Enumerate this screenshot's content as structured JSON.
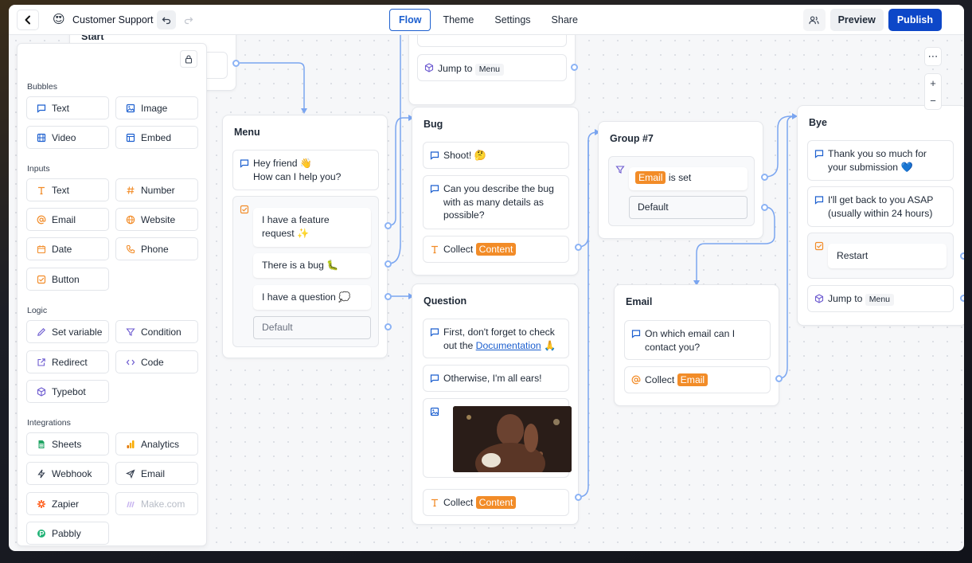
{
  "header": {
    "bot_name": "Customer Support",
    "bot_emoji": "😍",
    "tabs": [
      "Flow",
      "Theme",
      "Settings",
      "Share"
    ],
    "active_tab": "Flow",
    "preview_label": "Preview",
    "publish_label": "Publish"
  },
  "sidebar": {
    "sections": {
      "bubbles": "Bubbles",
      "inputs": "Inputs",
      "logic": "Logic",
      "integrations": "Integrations"
    },
    "bubbles": [
      "Text",
      "Image",
      "Video",
      "Embed"
    ],
    "inputs": [
      "Text",
      "Number",
      "Email",
      "Website",
      "Date",
      "Phone",
      "Button"
    ],
    "logic": [
      "Set variable",
      "Condition",
      "Redirect",
      "Code",
      "Typebot"
    ],
    "integrations": [
      "Sheets",
      "Analytics",
      "Webhook",
      "Email",
      "Zapier",
      "Make.com",
      "Pabbly"
    ]
  },
  "flow": {
    "start": {
      "title": "Start"
    },
    "top": {
      "jump_label": "Jump to",
      "jump_target": "Menu"
    },
    "menu": {
      "title": "Menu",
      "bubble_line1": "Hey friend 👋",
      "bubble_line2": "How can I help you?",
      "options": [
        "I have a feature request ✨",
        "There is a bug 🐛",
        "I have a question 💭"
      ],
      "default": "Default"
    },
    "bug": {
      "title": "Bug",
      "msg1": "Shoot! 🤔",
      "msg2": "Can you describe the bug with as many details as possible?",
      "collect_label": "Collect",
      "collect_var": "Content"
    },
    "question": {
      "title": "Question",
      "msg1_before": "First, don't forget to check out the ",
      "msg1_link": "Documentation",
      "msg1_after": " 🙏",
      "msg2": "Otherwise, I'm all ears!",
      "collect_label": "Collect",
      "collect_var": "Content"
    },
    "group7": {
      "title": "Group #7",
      "cond_var": "Email",
      "cond_text": "is set",
      "default": "Default"
    },
    "email": {
      "title": "Email",
      "msg": "On which email can I contact you?",
      "collect_label": "Collect",
      "collect_var": "Email"
    },
    "bye": {
      "title": "Bye",
      "msg1": "Thank you so much for your submission 💙",
      "msg2": "I'll get back to you ASAP (usually within 24 hours)",
      "restart": "Restart",
      "jump_label": "Jump to",
      "jump_target": "Menu"
    }
  },
  "zoom": {
    "in": "+",
    "out": "−",
    "more": "⋯"
  },
  "colors": {
    "accent": "#0d47c8",
    "variable": "#f28c28",
    "edge": "#7aa5f0"
  }
}
